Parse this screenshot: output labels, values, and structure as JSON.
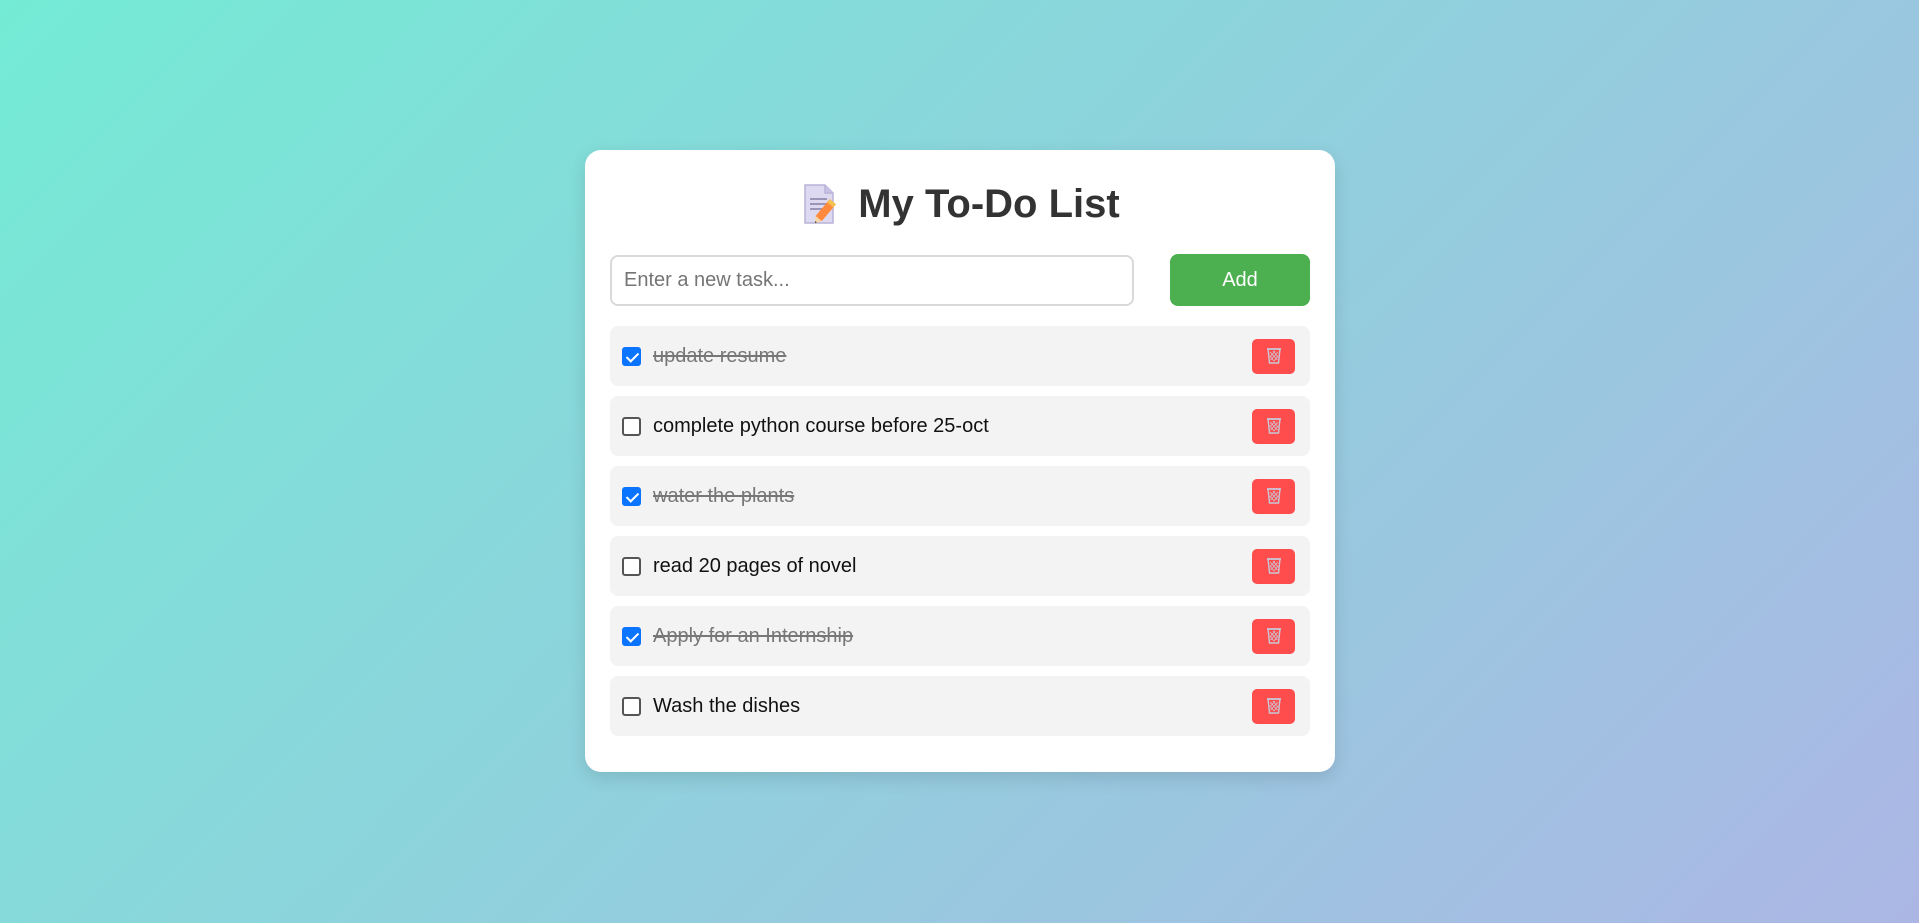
{
  "header": {
    "title": "My To-Do List",
    "icon": "memo-icon"
  },
  "new_task": {
    "placeholder": "Enter a new task...",
    "value": "",
    "add_label": "Add"
  },
  "tasks": [
    {
      "text": "update resume",
      "completed": true
    },
    {
      "text": "complete python course before 25-oct",
      "completed": false
    },
    {
      "text": "water the plants",
      "completed": true
    },
    {
      "text": "read 20 pages of novel",
      "completed": false
    },
    {
      "text": "Apply for an Internship",
      "completed": true
    },
    {
      "text": "Wash the dishes",
      "completed": false
    }
  ],
  "colors": {
    "background_start": "#74ebd5",
    "background_end": "#acb6e5",
    "add_button": "#4caf50",
    "delete_button": "#ff4d4d",
    "checkbox_checked": "#0b74ff"
  },
  "icons": {
    "delete": "wastebasket-icon"
  }
}
